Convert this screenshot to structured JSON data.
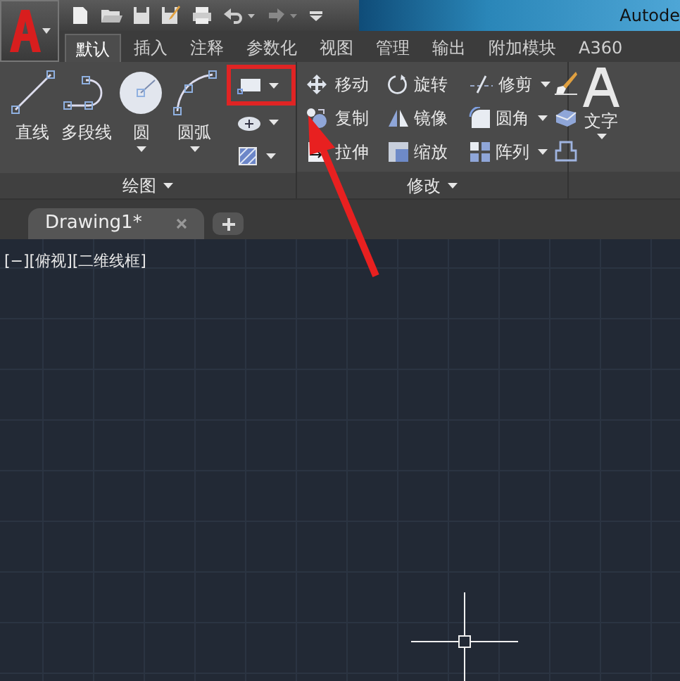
{
  "title_bar": {
    "title": "Autode"
  },
  "ribbon_tabs": [
    {
      "label": "默认",
      "selected": true
    },
    {
      "label": "插入",
      "selected": false
    },
    {
      "label": "注释",
      "selected": false
    },
    {
      "label": "参数化",
      "selected": false
    },
    {
      "label": "视图",
      "selected": false
    },
    {
      "label": "管理",
      "selected": false
    },
    {
      "label": "输出",
      "selected": false
    },
    {
      "label": "附加模块",
      "selected": false
    },
    {
      "label": "A360",
      "selected": false
    }
  ],
  "draw_panel": {
    "title": "绘图",
    "large_tools": [
      {
        "kind": "line",
        "label": "直线",
        "dropdown": false
      },
      {
        "kind": "polyline",
        "label": "多段线",
        "dropdown": false
      },
      {
        "kind": "circle",
        "label": "圆",
        "dropdown": true
      },
      {
        "kind": "arc",
        "label": "圆弧",
        "dropdown": true
      }
    ],
    "small_tools": [
      {
        "kind": "rectangle",
        "highlighted": true
      },
      {
        "kind": "ellipse",
        "highlighted": false
      },
      {
        "kind": "hatch",
        "highlighted": false
      }
    ]
  },
  "modify_panel": {
    "title": "修改",
    "rows": [
      [
        {
          "kind": "move",
          "label": "移动",
          "dropdown": false
        },
        {
          "kind": "rotate",
          "label": "旋转",
          "dropdown": false
        },
        {
          "kind": "trim",
          "label": "修剪",
          "dropdown": true
        }
      ],
      [
        {
          "kind": "copy",
          "label": "复制",
          "dropdown": false
        },
        {
          "kind": "mirror",
          "label": "镜像",
          "dropdown": false
        },
        {
          "kind": "fillet",
          "label": "圆角",
          "dropdown": true
        }
      ],
      [
        {
          "kind": "stretch",
          "label": "拉伸",
          "dropdown": false
        },
        {
          "kind": "scale",
          "label": "缩放",
          "dropdown": false
        },
        {
          "kind": "array",
          "label": "阵列",
          "dropdown": true
        }
      ]
    ],
    "side_tools": [
      {
        "kind": "erase"
      },
      {
        "kind": "explode"
      },
      {
        "kind": "offset"
      }
    ]
  },
  "text_panel": {
    "label": "文字"
  },
  "document_tabs": [
    {
      "label": "Drawing1*",
      "selected": true
    }
  ],
  "viewport": {
    "label": "[−][俯视][二维线框]"
  }
}
